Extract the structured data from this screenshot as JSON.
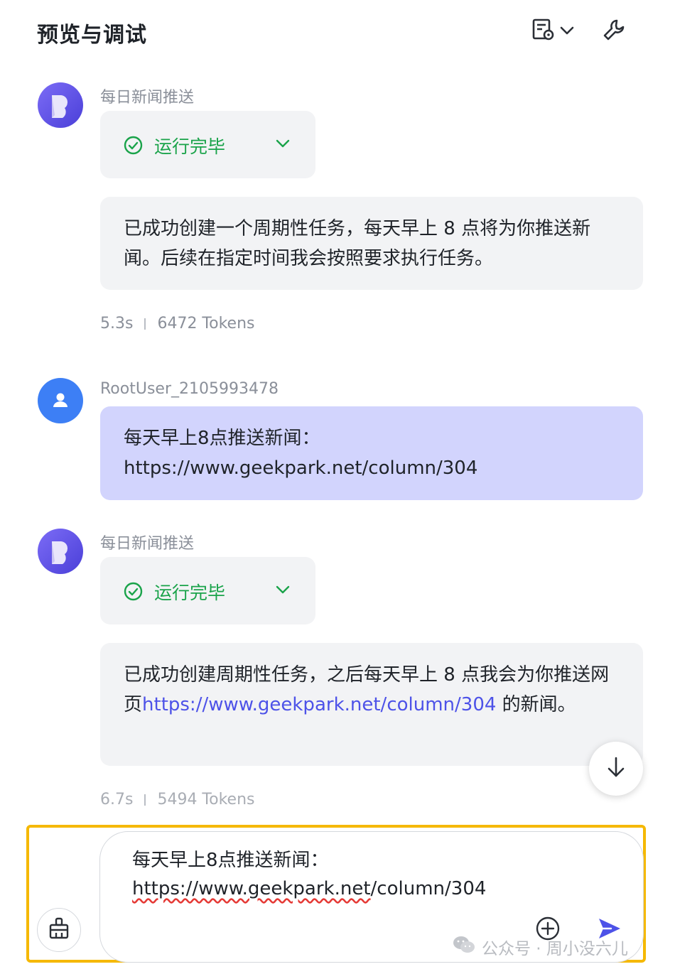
{
  "header": {
    "title": "预览与调试"
  },
  "messages": [
    {
      "sender": "每日新闻推送",
      "status": "运行完毕",
      "reply": "已成功创建一个周期性任务，每天早上 8 点将为你推送新闻。后续在指定时间我会按照要求执行任务。",
      "time": "5.3s",
      "tokens": "6472 Tokens"
    },
    {
      "sender": "RootUser_2105993478",
      "text_line1": "每天早上8点推送新闻：",
      "text_line2": "https://www.geekpark.net/column/304"
    },
    {
      "sender": "每日新闻推送",
      "status": "运行完毕",
      "reply_before": "已成功创建周期性任务，之后每天早上 8 点我会为你推送网页",
      "reply_link": "https://www.geekpark.net/column/304",
      "reply_after": " 的新闻。",
      "time": "6.7s",
      "tokens": "5494 Tokens"
    }
  ],
  "input": {
    "line1": "每天早上8点推送新闻：",
    "line2_spell": "https://www.geekpark.net",
    "line2_rest": "/column/304"
  },
  "watermark": {
    "text": "公众号 · 周小没六儿"
  },
  "colors": {
    "accent": "#4d52e8",
    "success": "#1aa34a",
    "user_bubble": "#d2d4fd",
    "bot_bubble": "#f2f3f5",
    "highlight": "#f5b800"
  }
}
